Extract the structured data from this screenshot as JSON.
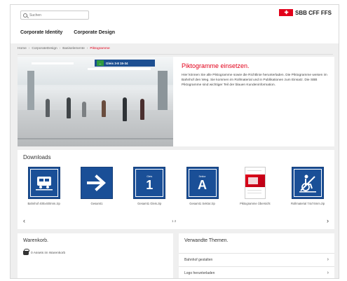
{
  "header": {
    "search_placeholder": "Suchen",
    "logo_flag": "✚",
    "logo_name": "SBB CFF FFS",
    "nav": [
      "Corporate Identity",
      "Corporate Design"
    ]
  },
  "breadcrumb": [
    {
      "label": "Home",
      "current": false
    },
    {
      "label": "CorporateDesign",
      "current": false
    },
    {
      "label": "Basiselemente",
      "current": false
    },
    {
      "label": "Piktogramme",
      "current": true
    }
  ],
  "hero": {
    "sign_text": "Gleis 3-8  15-34",
    "title": "Piktogramme einsetzen.",
    "body": "Hier können Sie alle Piktogramme sowie die Richtlinie herunterladen. Die Piktogramme weisen im Bahnhof den Weg. Sie kommen im Rollmaterial und in Publikationen zum Einsatz. Die SBB Piktogramme sind wichtiger Teil der blauen Kundeninformation."
  },
  "downloads": {
    "title": "Downloads",
    "items": [
      {
        "label": "Bahnhof 400x400mm.zip",
        "type": "train"
      },
      {
        "label": "Gesamt1",
        "type": "arrow"
      },
      {
        "label": "Gesamt1 Gleis.zip",
        "type": "number",
        "small": "Gleis",
        "big": "1"
      },
      {
        "label": "Gesamt1 Sektor.zip",
        "type": "number",
        "small": "Sektor",
        "big": "A"
      },
      {
        "label": "Piktogramme Übersicht",
        "type": "brochure"
      },
      {
        "label": "Rollmaterial 74x74mm.zip",
        "type": "wheelchair"
      }
    ],
    "pager": "1 2",
    "prev": "‹",
    "next": "›"
  },
  "cart": {
    "title": "Warenkorb.",
    "text": "0 Assets im Warenkorb"
  },
  "related": {
    "title": "Verwandte Themen.",
    "items": [
      "Bahnhof gestalten",
      "Logo herunterladen"
    ],
    "chevron": "›"
  },
  "colors": {
    "accent_red": "#e2001a",
    "pictogram_blue": "#1a4f97"
  }
}
